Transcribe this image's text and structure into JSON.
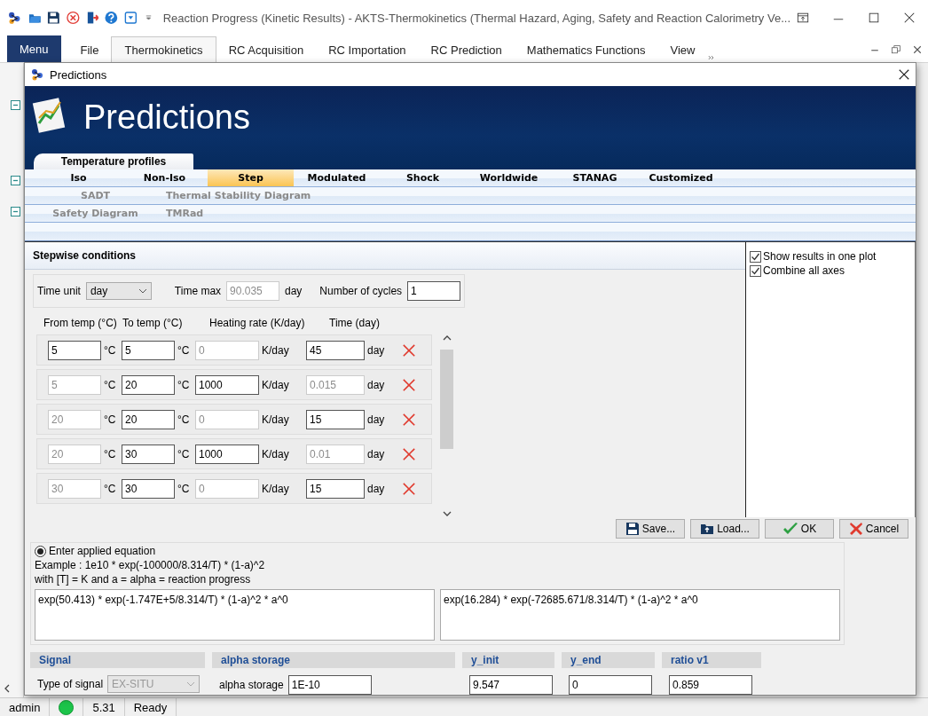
{
  "app_window": {
    "title": "Reaction Progress (Kinetic Results) - AKTS-Thermokinetics (Thermal Hazard, Aging, Safety and Reaction Calorimetry Ve...",
    "ribbon_tabs": [
      {
        "label": "Menu",
        "kind": "menu",
        "selected": false
      },
      {
        "label": "File",
        "kind": "tab",
        "selected": false
      },
      {
        "label": "Thermokinetics",
        "kind": "tab",
        "selected": true
      },
      {
        "label": "RC Acquisition",
        "kind": "tab",
        "selected": false
      },
      {
        "label": "RC Importation",
        "kind": "tab",
        "selected": false
      },
      {
        "label": "RC Prediction",
        "kind": "tab",
        "selected": false
      },
      {
        "label": "Mathematics Functions",
        "kind": "tab",
        "selected": false
      },
      {
        "label": "View",
        "kind": "tab",
        "selected": false
      }
    ],
    "status_bar": {
      "user": "admin",
      "version": "5.31",
      "status": "Ready"
    }
  },
  "dialog": {
    "title": "Predictions",
    "header": "Predictions",
    "section_tab": "Temperature profiles",
    "profile_rows": [
      {
        "kind": "main",
        "items": [
          {
            "label": "Iso",
            "selected": false,
            "disabled": false
          },
          {
            "label": "Non-Iso",
            "selected": false,
            "disabled": false
          },
          {
            "label": "Step",
            "selected": true,
            "disabled": false
          },
          {
            "label": "Modulated",
            "selected": false,
            "disabled": false
          },
          {
            "label": "Shock",
            "selected": false,
            "disabled": false
          },
          {
            "label": "Worldwide",
            "selected": false,
            "disabled": false
          },
          {
            "label": "STANAG",
            "selected": false,
            "disabled": false
          },
          {
            "label": "Customized",
            "selected": false,
            "disabled": false
          }
        ]
      },
      {
        "kind": "extra",
        "items": [
          {
            "label": "SADT",
            "selected": false,
            "disabled": true
          },
          {
            "label": "Thermal Stability Diagram",
            "selected": false,
            "disabled": true
          }
        ]
      },
      {
        "kind": "extra",
        "items": [
          {
            "label": "Safety Diagram",
            "selected": false,
            "disabled": true
          },
          {
            "label": "TMRad",
            "selected": false,
            "disabled": true
          }
        ]
      }
    ],
    "stepwise": {
      "title": "Stepwise conditions",
      "time_unit_label": "Time unit",
      "time_unit": "day",
      "time_max_label": "Time max",
      "time_max": "90.035",
      "time_max_unit": "day",
      "cycles_label": "Number of cycles",
      "cycles": "1",
      "columns": [
        "From temp (°C)",
        "To temp (°C)",
        "Heating rate (K/day)",
        "Time (day)"
      ],
      "steps": [
        {
          "cells": [
            {
              "value": "5",
              "disabled": false,
              "unit": "°C"
            },
            {
              "value": "5",
              "disabled": false,
              "unit": "°C"
            },
            {
              "value": "0",
              "disabled": true,
              "unit": "K/day"
            },
            {
              "value": "45",
              "disabled": false,
              "unit": "day"
            }
          ]
        },
        {
          "cells": [
            {
              "value": "5",
              "disabled": true,
              "unit": "°C"
            },
            {
              "value": "20",
              "disabled": false,
              "unit": "°C"
            },
            {
              "value": "1000",
              "disabled": false,
              "unit": "K/day"
            },
            {
              "value": "0.015",
              "disabled": true,
              "unit": "day"
            }
          ]
        },
        {
          "cells": [
            {
              "value": "20",
              "disabled": true,
              "unit": "°C"
            },
            {
              "value": "20",
              "disabled": false,
              "unit": "°C"
            },
            {
              "value": "0",
              "disabled": true,
              "unit": "K/day"
            },
            {
              "value": "15",
              "disabled": false,
              "unit": "day"
            }
          ]
        },
        {
          "cells": [
            {
              "value": "20",
              "disabled": true,
              "unit": "°C"
            },
            {
              "value": "30",
              "disabled": false,
              "unit": "°C"
            },
            {
              "value": "1000",
              "disabled": false,
              "unit": "K/day"
            },
            {
              "value": "0.01",
              "disabled": true,
              "unit": "day"
            }
          ]
        },
        {
          "cells": [
            {
              "value": "30",
              "disabled": true,
              "unit": "°C"
            },
            {
              "value": "30",
              "disabled": false,
              "unit": "°C"
            },
            {
              "value": "0",
              "disabled": true,
              "unit": "K/day"
            },
            {
              "value": "15",
              "disabled": false,
              "unit": "day"
            }
          ]
        }
      ]
    },
    "options": [
      {
        "label": "Show results in one plot",
        "checked": true
      },
      {
        "label": "Combine all axes",
        "checked": true
      }
    ],
    "buttons": [
      {
        "label": "Save...",
        "kind": "save"
      },
      {
        "label": "Load...",
        "kind": "load"
      },
      {
        "label": "OK",
        "kind": "ok"
      },
      {
        "label": "Cancel",
        "kind": "cancel"
      }
    ],
    "equation": {
      "radio_label": "Enter applied equation",
      "selected": true,
      "example": "Example :  1e10 * exp(-100000/8.314/T) * (1-a)^2",
      "note": "with [T] = K and a = alpha = reaction progress",
      "inputs": [
        "exp(50.413) * exp(-1.747E+5/8.314/T) * (1-a)^2 * a^0",
        "exp(16.284) * exp(-72685.671/8.314/T) * (1-a)^2 * a^0"
      ]
    },
    "groups": [
      {
        "title": "Signal",
        "label": "Type of signal",
        "value": "EX-SITU",
        "kind": "select",
        "disabled": true
      },
      {
        "title": "alpha storage",
        "label": "alpha storage",
        "value": "1E-10",
        "kind": "input",
        "disabled": false
      },
      {
        "title": "y_init",
        "value": "9.547",
        "kind": "input",
        "disabled": false
      },
      {
        "title": "y_end",
        "value": "0",
        "kind": "input",
        "disabled": false
      },
      {
        "title": "ratio v1",
        "value": "0.859",
        "kind": "input",
        "disabled": false
      }
    ]
  }
}
